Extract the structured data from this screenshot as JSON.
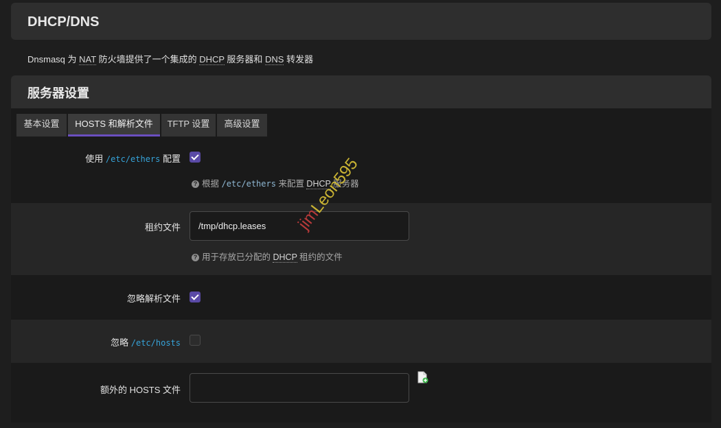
{
  "page": {
    "title": "DHCP/DNS"
  },
  "description": {
    "p1": "Dnsmasq 为 ",
    "nat": "NAT",
    "p2": " 防火墙提供了一个集成的 ",
    "dhcp": "DHCP",
    "p3": " 服务器和 ",
    "dns": "DNS",
    "p4": " 转发器"
  },
  "section": {
    "title": "服务器设置"
  },
  "tabs": [
    {
      "label": "基本设置",
      "active": false
    },
    {
      "label": "HOSTS 和解析文件",
      "active": true
    },
    {
      "label": "TFTP 设置",
      "active": false
    },
    {
      "label": "高级设置",
      "active": false
    }
  ],
  "fields": {
    "use_ethers": {
      "label_pre": "使用 ",
      "label_code": "/etc/ethers",
      "label_post": " 配置",
      "checked": true,
      "help_pre": "根据 ",
      "help_code": "/etc/ethers",
      "help_mid": " 来配置 ",
      "help_abbr": "DHCP",
      "help_post": " 服务器"
    },
    "leasefile": {
      "label": "租约文件",
      "value": "/tmp/dhcp.leases",
      "help_pre": "用于存放已分配的 ",
      "help_abbr": "DHCP",
      "help_post": " 租约的文件"
    },
    "noresolv": {
      "label": "忽略解析文件",
      "checked": true
    },
    "nohosts": {
      "label_pre": "忽略 ",
      "label_code": "/etc/hosts",
      "checked": false
    },
    "addnhosts": {
      "label": "额外的 HOSTS 文件",
      "value": ""
    }
  },
  "watermark": {
    "part1": "jim",
    "part2": "Leon595"
  },
  "colors": {
    "accent": "#5a4aa6",
    "tab_underline": "#6b4fc1",
    "code": "#36a3d9"
  },
  "icons": {
    "file_browse": "file-add-icon",
    "help": "question-circle-icon"
  }
}
